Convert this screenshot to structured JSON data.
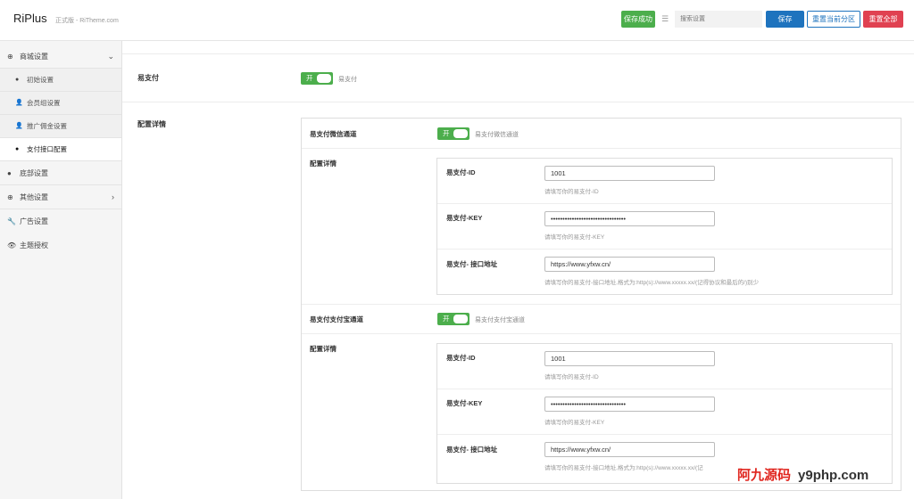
{
  "header": {
    "logo": "RiPlus",
    "logo_sub": "正式版 - RiTheme.com",
    "saved_badge": "保存成功",
    "search_placeholder": "搜索设置",
    "save": "保存",
    "reset_section": "重置当前分区",
    "reset_all": "重置全部"
  },
  "sidebar": {
    "group_shop": "商城设置",
    "sub_items": [
      "初始设置",
      "会员组设置",
      "推广佣金设置",
      "支付接口配置"
    ],
    "footer": "底部设置",
    "other": "其他设置",
    "ads": "广告设置",
    "license": "主题授权"
  },
  "main": {
    "yzf_label": "易支付",
    "yzf_toggle": "开",
    "yzf_desc": "易支付",
    "config_label": "配置详情",
    "wechat": {
      "label": "易支付微信通道",
      "toggle": "开",
      "desc": "易支付微信通道",
      "config_label": "配置详情",
      "id_label": "易支付-ID",
      "id_value": "1001",
      "id_help": "请填写你的易支付-ID",
      "key_label": "易支付-KEY",
      "key_value": "••••••••••••••••••••••••••••••••",
      "key_help": "请填写你的易支付-KEY",
      "url_label": "易支付- 接口地址",
      "url_value": "https://www.yfxw.cn/",
      "url_help": "请填写你的易支付-接口地址,格式为:http(s)://www.xxxxx.xx/(记得协议和最后的/)别少"
    },
    "alipay": {
      "label": "易支付支付宝通道",
      "toggle": "开",
      "desc": "易支付支付宝通道",
      "config_label": "配置详情",
      "id_label": "易支付-ID",
      "id_value": "1001",
      "id_help": "请填写你的易支付-ID",
      "key_label": "易支付-KEY",
      "key_value": "••••••••••••••••••••••••••••••••",
      "key_help": "请填写你的易支付-KEY",
      "url_label": "易支付- 接口地址",
      "url_value": "https://www.yfxw.cn/",
      "url_help": "请填写你的易支付-接口地址,格式为:http(s)://www.xxxxx.xx/(记"
    }
  },
  "watermark": {
    "cn": "阿九源码",
    "url": "y9php.com"
  }
}
